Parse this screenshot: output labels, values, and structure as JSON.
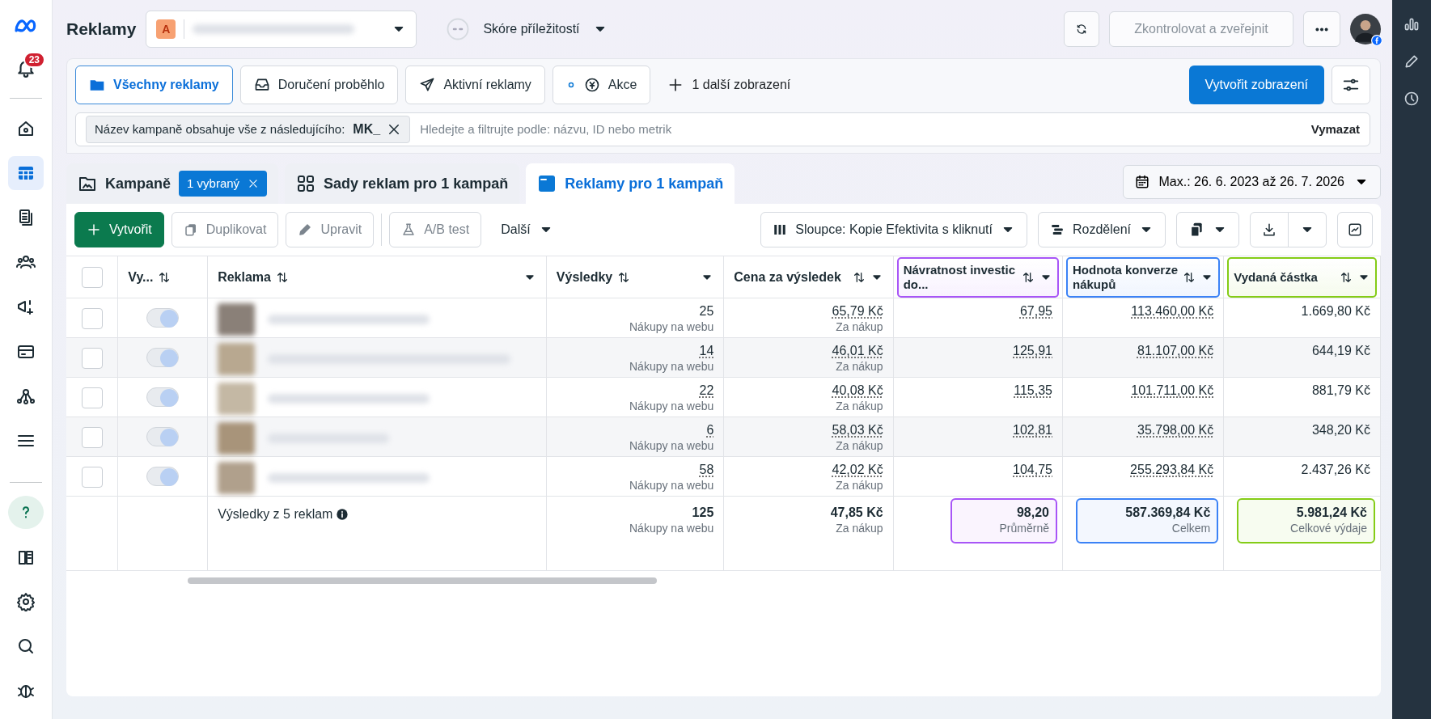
{
  "sidebar": {
    "notification_badge": "23",
    "items": [
      {
        "selected": false
      },
      {
        "selected": true
      },
      {
        "selected": false
      },
      {
        "selected": false
      },
      {
        "selected": false
      },
      {
        "selected": false
      },
      {
        "selected": false
      },
      {
        "selected": false
      }
    ],
    "bottom_items": [
      {
        "selected": true
      },
      {
        "selected": false
      },
      {
        "selected": false
      },
      {
        "selected": false
      },
      {
        "selected": false
      }
    ]
  },
  "header": {
    "title": "Reklamy",
    "account_letter": "A",
    "opportunity_label": "Skóre příležitostí",
    "review_button": {
      "label": "Zkontrolovat a zveřejnit",
      "disabled": true
    }
  },
  "views": {
    "tabs": [
      {
        "label": "Všechny reklamy",
        "selected": true
      },
      {
        "label": "Doručení proběhlo",
        "selected": false
      },
      {
        "label": "Aktivní reklamy",
        "selected": false
      },
      {
        "label": "Akce",
        "selected": false
      }
    ],
    "more_views": "1 další zobrazení",
    "create_view": "Vytvořit zobrazení"
  },
  "filter": {
    "chip_label": "Název kampaně obsahuje vše z následujícího:",
    "chip_value": "MK_",
    "placeholder": "Hledejte a filtrujte podle: názvu, ID nebo metrik",
    "clear": "Vymazat"
  },
  "levels": [
    {
      "label": "Kampaně",
      "selected": false,
      "badge": "1 vybraný"
    },
    {
      "label": "Sady reklam pro 1 kampaň",
      "selected": false
    },
    {
      "label": "Reklamy pro 1 kampaň",
      "selected": true
    }
  ],
  "date_range": "Max.: 26. 6. 2023 až 26. 7. 2026",
  "toolbar": {
    "create": "Vytvořit",
    "actions": [
      {
        "label": "Duplikovat",
        "disabled": true
      },
      {
        "label": "Upravit",
        "disabled": true
      },
      {
        "label": "A/B test",
        "disabled": true
      }
    ],
    "more": "Další",
    "columns": "Sloupce: Kopie Efektivita s kliknutí",
    "breakdown": "Rozdělení"
  },
  "table": {
    "select_all_checked": false,
    "columns": [
      {
        "label": "Vy..."
      },
      {
        "label": "Reklama"
      },
      {
        "label": "Výsledky"
      },
      {
        "label": "Cena za výsledek"
      },
      {
        "label": "Návratnost investic do...",
        "color": "#a855f7"
      },
      {
        "label": "Hodnota konverze nákupů",
        "color": "#3b82f6"
      },
      {
        "label": "Vydaná částka",
        "color": "#84cc16"
      }
    ],
    "rows": [
      {
        "checked": false,
        "on": true,
        "results": {
          "value": "25",
          "sub": "Nákupy na webu",
          "underlined": false
        },
        "cost": {
          "value": "65,79 Kč",
          "sub": "Za nákup"
        },
        "roas": "67,95",
        "value": "113.460,00 Kč",
        "spent": "1.669,80 Kč"
      },
      {
        "checked": false,
        "on": true,
        "results": {
          "value": "14",
          "sub": "Nákupy na webu",
          "underlined": true
        },
        "cost": {
          "value": "46,01 Kč",
          "sub": "Za nákup"
        },
        "roas": "125,91",
        "value": "81.107,00 Kč",
        "spent": "644,19 Kč"
      },
      {
        "checked": false,
        "on": true,
        "results": {
          "value": "22",
          "sub": "Nákupy na webu",
          "underlined": true
        },
        "cost": {
          "value": "40,08 Kč",
          "sub": "Za nákup"
        },
        "roas": "115,35",
        "value": "101.711,00 Kč",
        "spent": "881,79 Kč"
      },
      {
        "checked": false,
        "on": true,
        "results": {
          "value": "6",
          "sub": "Nákupy na webu",
          "underlined": true
        },
        "cost": {
          "value": "58,03 Kč",
          "sub": "Za nákup"
        },
        "roas": "102,81",
        "value": "35.798,00 Kč",
        "spent": "348,20 Kč"
      },
      {
        "checked": false,
        "on": true,
        "results": {
          "value": "58",
          "sub": "Nákupy na webu",
          "underlined": true
        },
        "cost": {
          "value": "42,02 Kč",
          "sub": "Za nákup"
        },
        "roas": "104,75",
        "value": "255.293,84 Kč",
        "spent": "2.437,26 Kč"
      }
    ],
    "summary": {
      "label": "Výsledky z 5 reklam",
      "results": {
        "value": "125",
        "sub": "Nákupy na webu"
      },
      "cost": {
        "value": "47,85 Kč",
        "sub": "Za nákup"
      },
      "roas": {
        "value": "98,20",
        "sub": "Průměrně"
      },
      "value": {
        "value": "587.369,84 Kč",
        "sub": "Celkem"
      },
      "spent": {
        "value": "5.981,24 Kč",
        "sub": "Celkové výdaje"
      }
    }
  }
}
